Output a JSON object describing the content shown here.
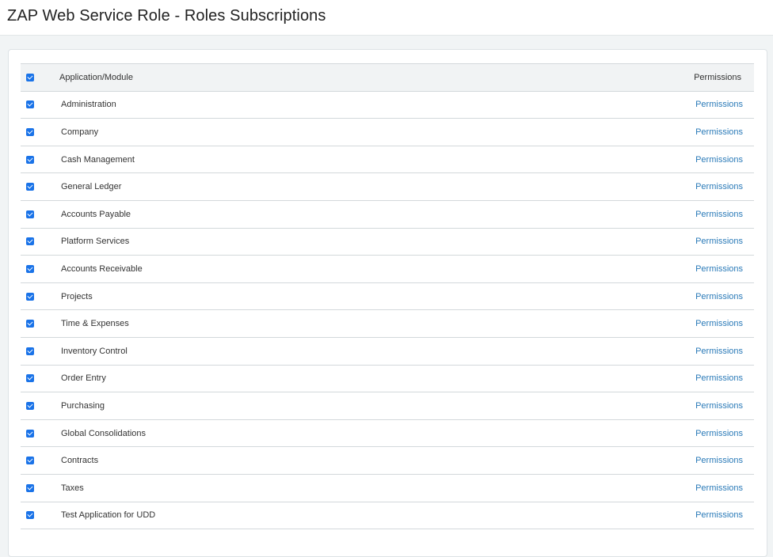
{
  "page": {
    "title": "ZAP Web Service Role - Roles Subscriptions"
  },
  "table": {
    "header": {
      "select_all_checked": true,
      "col_module": "Application/Module",
      "col_permissions": "Permissions"
    },
    "rows": [
      {
        "module": "Administration",
        "checked": true,
        "link": "Permissions"
      },
      {
        "module": "Company",
        "checked": true,
        "link": "Permissions"
      },
      {
        "module": "Cash Management",
        "checked": true,
        "link": "Permissions"
      },
      {
        "module": "General Ledger",
        "checked": true,
        "link": "Permissions"
      },
      {
        "module": "Accounts Payable",
        "checked": true,
        "link": "Permissions"
      },
      {
        "module": "Platform Services",
        "checked": true,
        "link": "Permissions"
      },
      {
        "module": "Accounts Receivable",
        "checked": true,
        "link": "Permissions"
      },
      {
        "module": "Projects",
        "checked": true,
        "link": "Permissions"
      },
      {
        "module": "Time & Expenses",
        "checked": true,
        "link": "Permissions"
      },
      {
        "module": "Inventory Control",
        "checked": true,
        "link": "Permissions"
      },
      {
        "module": "Order Entry",
        "checked": true,
        "link": "Permissions"
      },
      {
        "module": "Purchasing",
        "checked": true,
        "link": "Permissions"
      },
      {
        "module": "Global Consolidations",
        "checked": true,
        "link": "Permissions"
      },
      {
        "module": "Contracts",
        "checked": true,
        "link": "Permissions"
      },
      {
        "module": "Taxes",
        "checked": true,
        "link": "Permissions"
      },
      {
        "module": "Test Application for UDD",
        "checked": true,
        "link": "Permissions"
      }
    ]
  },
  "colors": {
    "checkbox": "#1a73e8",
    "link": "#2a7ab8"
  }
}
